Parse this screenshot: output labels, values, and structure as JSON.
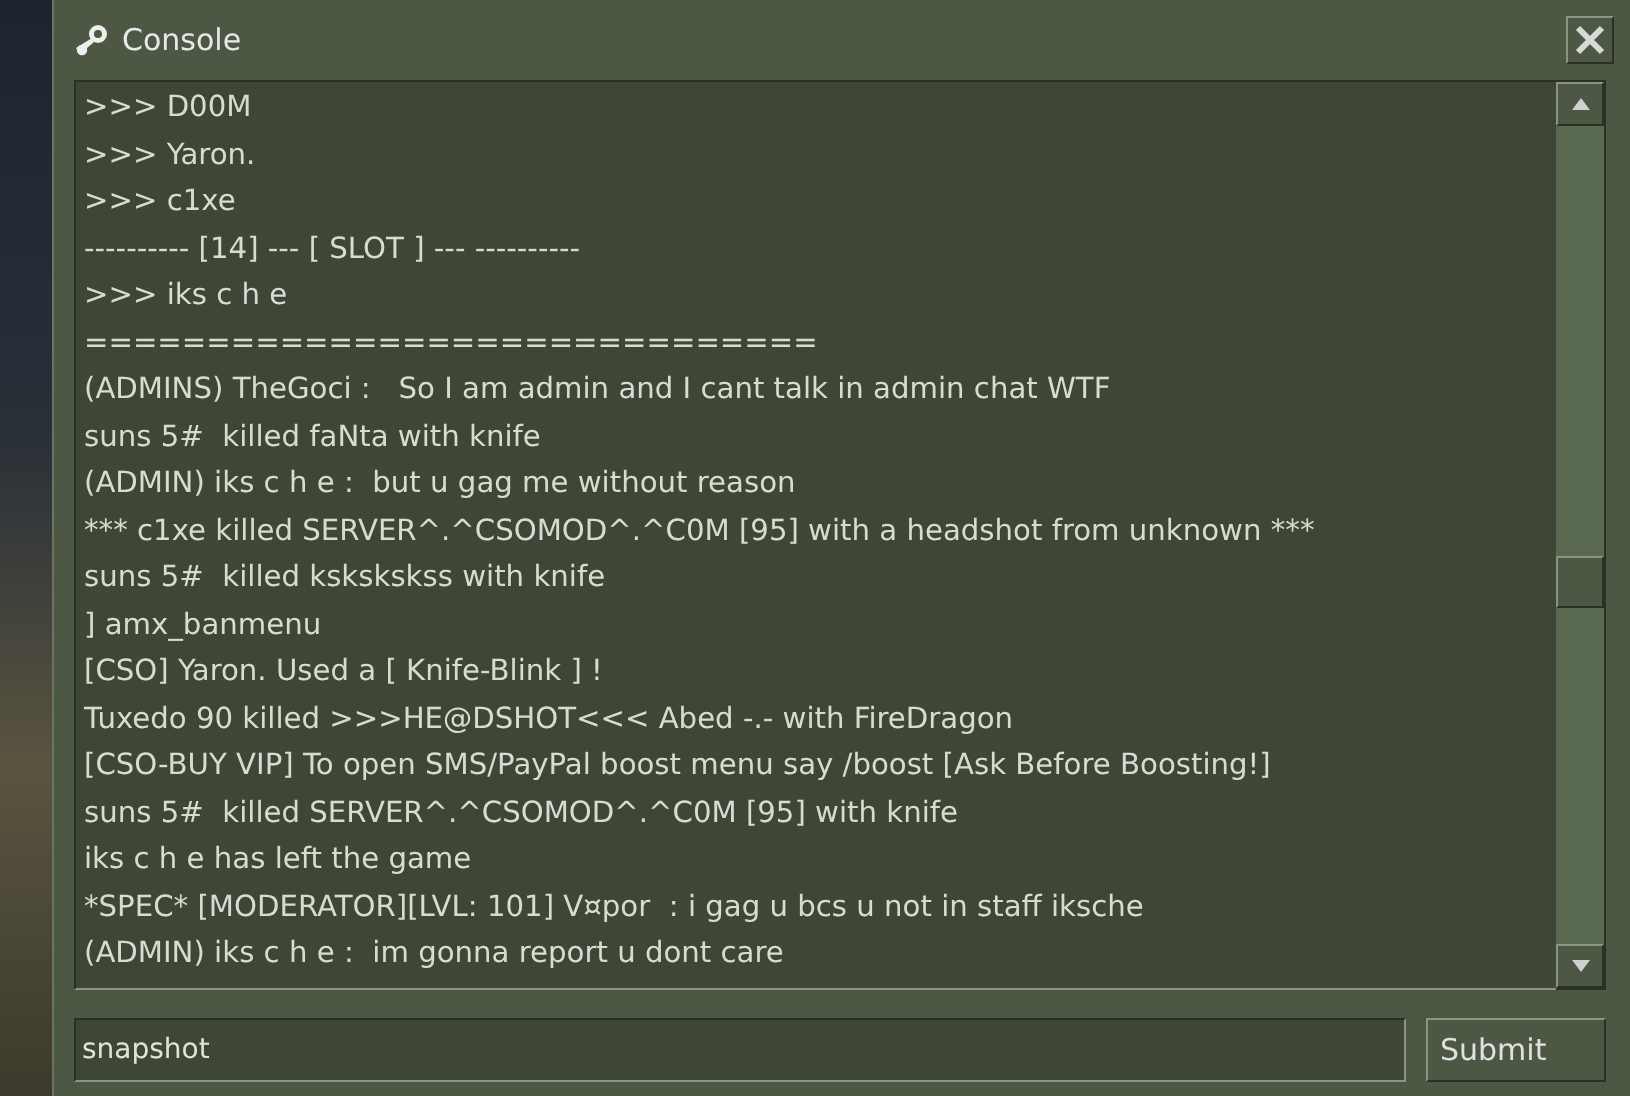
{
  "window": {
    "title": "Console"
  },
  "log_lines": [
    ">>> D00M",
    ">>> Yaron.",
    ">>> c1xe",
    "---------- [14] --- [ SLOT ] --- ----------",
    ">>> iks c h e",
    "==============================",
    "(ADMINS) TheGoci :   So I am admin and I cant talk in admin chat WTF",
    "suns 5#  killed faNta with knife",
    "(ADMIN) iks c h e :  but u gag me without reason",
    "*** c1xe killed SERVER^.^CSOMOD^.^C0M [95] with a headshot from unknown ***",
    "suns 5#  killed kskskskss with knife",
    "] amx_banmenu",
    "[CSO] Yaron. Used a [ Knife-Blink ] !",
    "Tuxedo 90 killed >>>HE@DSHOT<<< Abed -.- with FireDragon",
    "[CSO-BUY VIP] To open SMS/PayPal boost menu say /boost [Ask Before Boosting!]",
    "suns 5#  killed SERVER^.^CSOMOD^.^C0M [95] with knife",
    "iks c h e has left the game",
    "*SPEC* [MODERATOR][LVL: 101] V¤por  : i gag u bcs u not in staff iksche",
    "(ADMIN) iks c h e :  im gonna report u dont care"
  ],
  "input": {
    "value": "snapshot"
  },
  "submit_button": "Submit"
}
